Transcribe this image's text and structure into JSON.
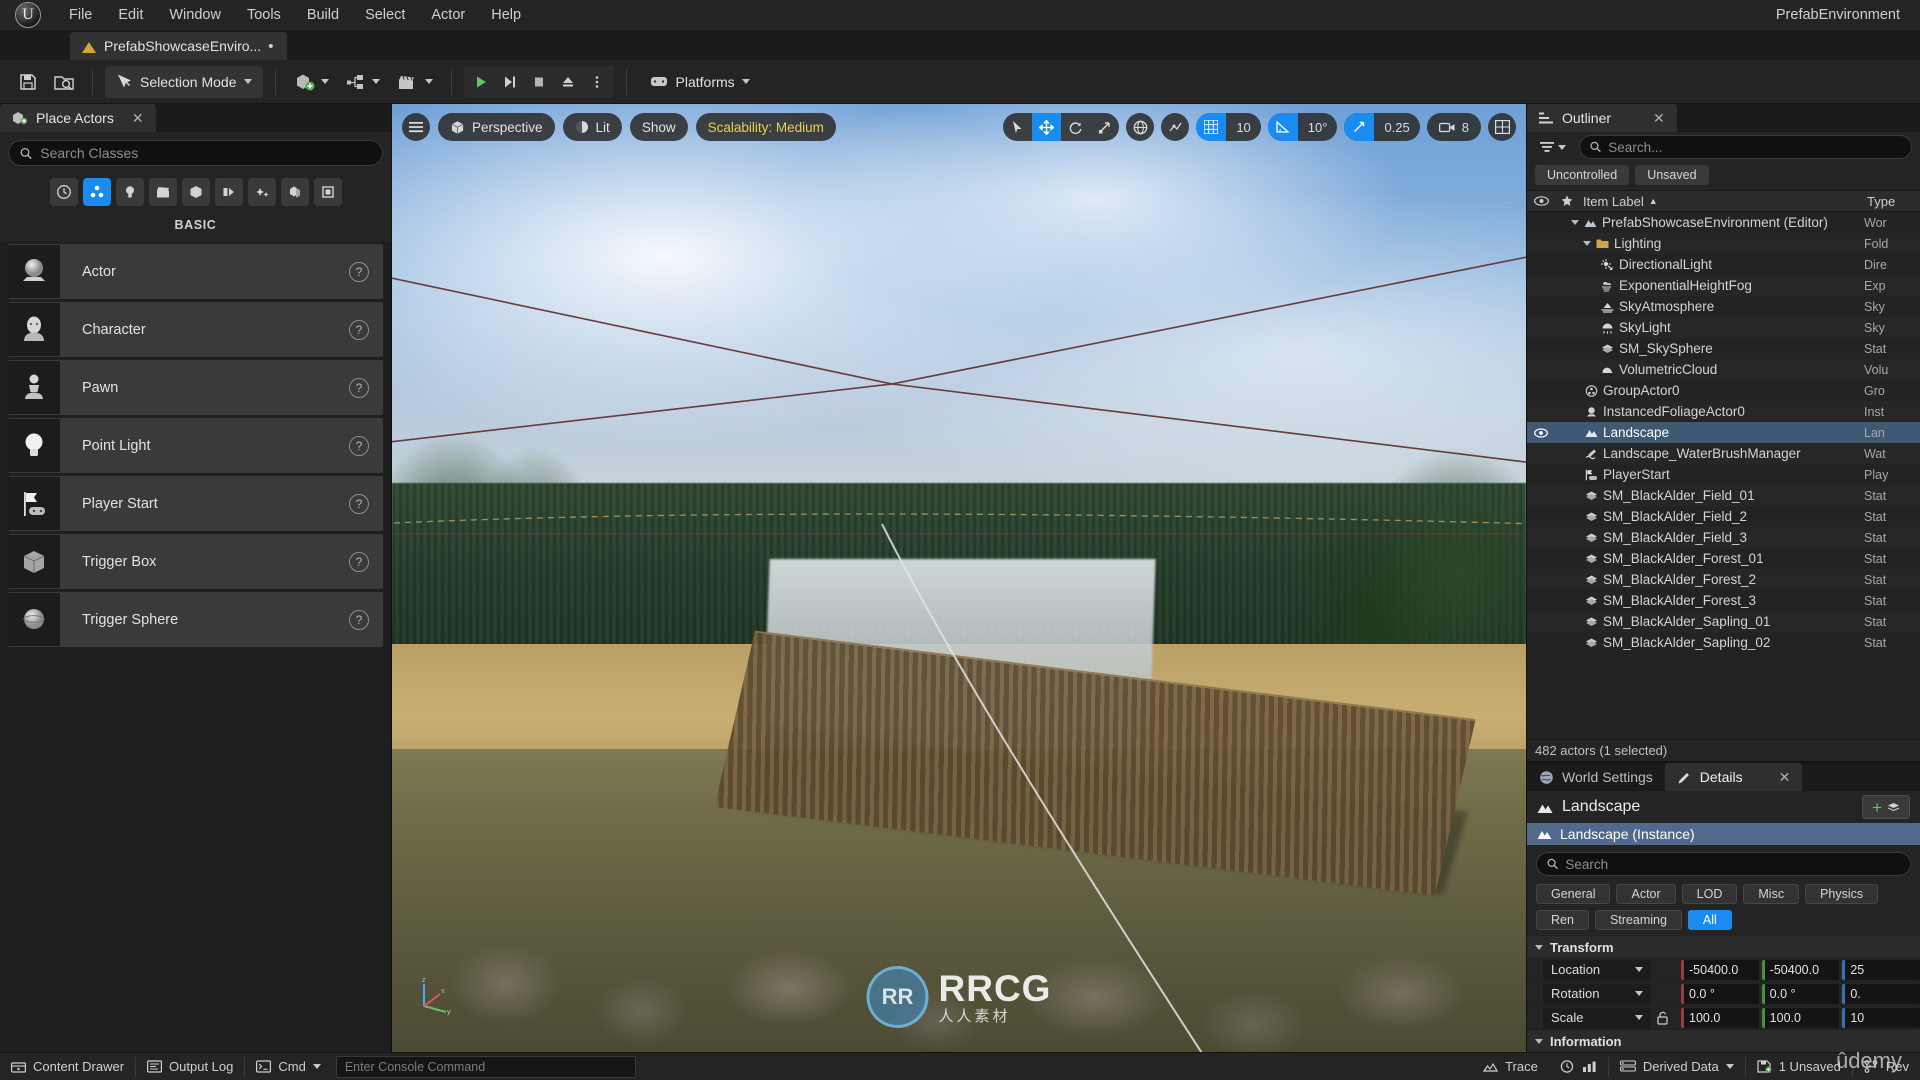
{
  "menu": {
    "items": [
      "File",
      "Edit",
      "Window",
      "Tools",
      "Build",
      "Select",
      "Actor",
      "Help"
    ],
    "env_label": "PrefabEnvironment",
    "logo": "unreal-engine-logo"
  },
  "tab": {
    "project_name": "PrefabShowcaseEnviro...",
    "dirty_marker": "•"
  },
  "toolbar": {
    "save_icon": "save-icon",
    "browse_icon": "browse-content-icon",
    "mode_label": "Selection Mode",
    "add_icon": "add-actor-icon",
    "blueprint_icon": "blueprints-icon",
    "cinematics_icon": "cinematics-icon",
    "play_icon": "play-icon",
    "skip_icon": "skip-icon",
    "stop_icon": "stop-icon",
    "eject_icon": "eject-icon",
    "more_icon": "more-options-icon",
    "platforms_label": "Platforms"
  },
  "place_actors": {
    "tab_label": "Place Actors",
    "close_icon": "close-icon",
    "search_placeholder": "Search Classes",
    "categories": [
      {
        "name": "recently-placed",
        "icon": "clock-icon",
        "active": false
      },
      {
        "name": "basic",
        "icon": "basic-shapes-icon",
        "active": true
      },
      {
        "name": "lights",
        "icon": "light-bulb-icon",
        "active": false
      },
      {
        "name": "cinematic",
        "icon": "clapperboard-icon",
        "active": false
      },
      {
        "name": "visual-effects",
        "icon": "cube-icon",
        "active": false
      },
      {
        "name": "geometry",
        "icon": "geometry-icon",
        "active": false
      },
      {
        "name": "volumes",
        "icon": "sparkle-icon",
        "active": false
      },
      {
        "name": "all-classes",
        "icon": "layers-icon",
        "active": false
      },
      {
        "name": "shapes",
        "icon": "square-icon",
        "active": false
      }
    ],
    "section_header": "BASIC",
    "items": [
      {
        "label": "Actor",
        "icon": "actor-sphere-icon",
        "help": "?"
      },
      {
        "label": "Character",
        "icon": "character-head-icon",
        "help": "?"
      },
      {
        "label": "Pawn",
        "icon": "pawn-piece-icon",
        "help": "?"
      },
      {
        "label": "Point Light",
        "icon": "point-light-icon",
        "help": "?"
      },
      {
        "label": "Player Start",
        "icon": "player-start-icon",
        "help": "?"
      },
      {
        "label": "Trigger Box",
        "icon": "trigger-box-icon",
        "help": "?"
      },
      {
        "label": "Trigger Sphere",
        "icon": "trigger-sphere-icon",
        "help": "?"
      }
    ]
  },
  "viewport": {
    "menu_icon": "viewport-menu-icon",
    "camera_label": "Perspective",
    "viewmode_label": "Lit",
    "show_label": "Show",
    "scalability_label": "Scalability: Medium",
    "gizmos": [
      {
        "name": "select-tool",
        "icon": "cursor-arrow-icon",
        "active": false
      },
      {
        "name": "translate-tool",
        "icon": "move-arrows-icon",
        "active": true
      },
      {
        "name": "rotate-tool",
        "icon": "rotate-icon",
        "active": false
      },
      {
        "name": "scale-tool",
        "icon": "scale-icon",
        "active": false
      }
    ],
    "coord_icon": "world-globe-icon",
    "surface_snap_icon": "surface-snap-icon",
    "grid_snap_value": "10",
    "angle_snap_value": "10°",
    "scale_snap_value": "0.25",
    "camera_speed_value": "8",
    "layout_icon": "viewport-layout-icon",
    "watermark_main": "RRCG",
    "watermark_sub": "人人素材",
    "watermark_badge": "RR",
    "brand": "ûdemy"
  },
  "outliner": {
    "tab_label": "Outliner",
    "close_icon": "close-icon",
    "filter_icon": "filter-funnel-icon",
    "search_placeholder": "Search...",
    "chips": [
      "Uncontrolled",
      "Unsaved"
    ],
    "columns": {
      "eye": "eye-icon",
      "star": "star-icon",
      "label": "Item Label",
      "type": "Type"
    },
    "sort_icon": "sort-asc-icon",
    "rows": [
      {
        "label": "PrefabShowcaseEnvironment (Editor)",
        "type": "Wor",
        "icon": "world-icon",
        "indent": 1,
        "expander": true,
        "selected": false,
        "eye": false
      },
      {
        "label": "Lighting",
        "type": "Fold",
        "icon": "folder-icon",
        "indent": 2,
        "expander": true,
        "selected": false,
        "eye": false
      },
      {
        "label": "DirectionalLight",
        "type": "Dire",
        "icon": "directional-light-icon",
        "indent": 3,
        "expander": false,
        "selected": false,
        "eye": false
      },
      {
        "label": "ExponentialHeightFog",
        "type": "Exp",
        "icon": "fog-icon",
        "indent": 3,
        "expander": false,
        "selected": false,
        "eye": false
      },
      {
        "label": "SkyAtmosphere",
        "type": "Sky",
        "icon": "sky-atmosphere-icon",
        "indent": 3,
        "expander": false,
        "selected": false,
        "eye": false
      },
      {
        "label": "SkyLight",
        "type": "Sky",
        "icon": "sky-light-icon",
        "indent": 3,
        "expander": false,
        "selected": false,
        "eye": false
      },
      {
        "label": "SM_SkySphere",
        "type": "Stat",
        "icon": "static-mesh-icon",
        "indent": 3,
        "expander": false,
        "selected": false,
        "eye": false
      },
      {
        "label": "VolumetricCloud",
        "type": "Volu",
        "icon": "volumetric-cloud-icon",
        "indent": 3,
        "expander": false,
        "selected": false,
        "eye": false
      },
      {
        "label": "GroupActor0",
        "type": "Gro",
        "icon": "group-actor-icon",
        "indent": 2,
        "expander": false,
        "selected": false,
        "eye": false
      },
      {
        "label": "InstancedFoliageActor0",
        "type": "Inst",
        "icon": "foliage-actor-icon",
        "indent": 2,
        "expander": false,
        "selected": false,
        "eye": false
      },
      {
        "label": "Landscape",
        "type": "Lan",
        "icon": "landscape-icon",
        "indent": 2,
        "expander": false,
        "selected": true,
        "eye": true
      },
      {
        "label": "Landscape_WaterBrushManager",
        "type": "Wat",
        "icon": "water-brush-icon",
        "indent": 2,
        "expander": false,
        "selected": false,
        "eye": false
      },
      {
        "label": "PlayerStart",
        "type": "Play",
        "icon": "player-start-icon",
        "indent": 2,
        "expander": false,
        "selected": false,
        "eye": false
      },
      {
        "label": "SM_BlackAlder_Field_01",
        "type": "Stat",
        "icon": "static-mesh-icon",
        "indent": 2,
        "expander": false,
        "selected": false,
        "eye": false
      },
      {
        "label": "SM_BlackAlder_Field_2",
        "type": "Stat",
        "icon": "static-mesh-icon",
        "indent": 2,
        "expander": false,
        "selected": false,
        "eye": false
      },
      {
        "label": "SM_BlackAlder_Field_3",
        "type": "Stat",
        "icon": "static-mesh-icon",
        "indent": 2,
        "expander": false,
        "selected": false,
        "eye": false
      },
      {
        "label": "SM_BlackAlder_Forest_01",
        "type": "Stat",
        "icon": "static-mesh-icon",
        "indent": 2,
        "expander": false,
        "selected": false,
        "eye": false
      },
      {
        "label": "SM_BlackAlder_Forest_2",
        "type": "Stat",
        "icon": "static-mesh-icon",
        "indent": 2,
        "expander": false,
        "selected": false,
        "eye": false
      },
      {
        "label": "SM_BlackAlder_Forest_3",
        "type": "Stat",
        "icon": "static-mesh-icon",
        "indent": 2,
        "expander": false,
        "selected": false,
        "eye": false
      },
      {
        "label": "SM_BlackAlder_Sapling_01",
        "type": "Stat",
        "icon": "static-mesh-icon",
        "indent": 2,
        "expander": false,
        "selected": false,
        "eye": false
      },
      {
        "label": "SM_BlackAlder_Sapling_02",
        "type": "Stat",
        "icon": "static-mesh-icon",
        "indent": 2,
        "expander": false,
        "selected": false,
        "eye": false
      }
    ],
    "status": "482 actors (1 selected)"
  },
  "details": {
    "tabs": [
      {
        "label": "World Settings",
        "icon": "world-settings-icon",
        "active": false
      },
      {
        "label": "Details",
        "icon": "details-pencil-icon",
        "active": true
      }
    ],
    "close_icon": "close-icon",
    "actor_name": "Landscape",
    "actor_icon": "landscape-icon",
    "add_component_label": "+",
    "instance_row": "Landscape (Instance)",
    "search_placeholder": "Search",
    "filters": [
      {
        "label": "General",
        "active": false
      },
      {
        "label": "Actor",
        "active": false
      },
      {
        "label": "LOD",
        "active": false
      },
      {
        "label": "Misc",
        "active": false
      },
      {
        "label": "Physics",
        "active": false
      },
      {
        "label": "Ren",
        "active": false
      },
      {
        "label": "Streaming",
        "active": false
      },
      {
        "label": "All",
        "active": true
      }
    ],
    "transform_header": "Transform",
    "transform_rows": [
      {
        "label": "Location",
        "x": "-50400.0",
        "y": "-50400.0",
        "z": "25",
        "lock": false
      },
      {
        "label": "Rotation",
        "x": "0.0 °",
        "y": "0.0 °",
        "z": "0.",
        "lock": false
      },
      {
        "label": "Scale",
        "x": "100.0",
        "y": "100.0",
        "z": "10",
        "lock": true
      }
    ],
    "information_header": "Information"
  },
  "statusbar": {
    "content_drawer": "Content Drawer",
    "output_log": "Output Log",
    "cmd_label": "Cmd",
    "cmd_placeholder": "Enter Console Command",
    "trace": "Trace",
    "derived_data": "Derived Data",
    "unsaved": "1 Unsaved",
    "revision": "Rev"
  },
  "colors": {
    "accent": "#1a8cf0",
    "selection": "#3f5873",
    "warning": "#e8d24a",
    "green": "#5ec25e"
  }
}
